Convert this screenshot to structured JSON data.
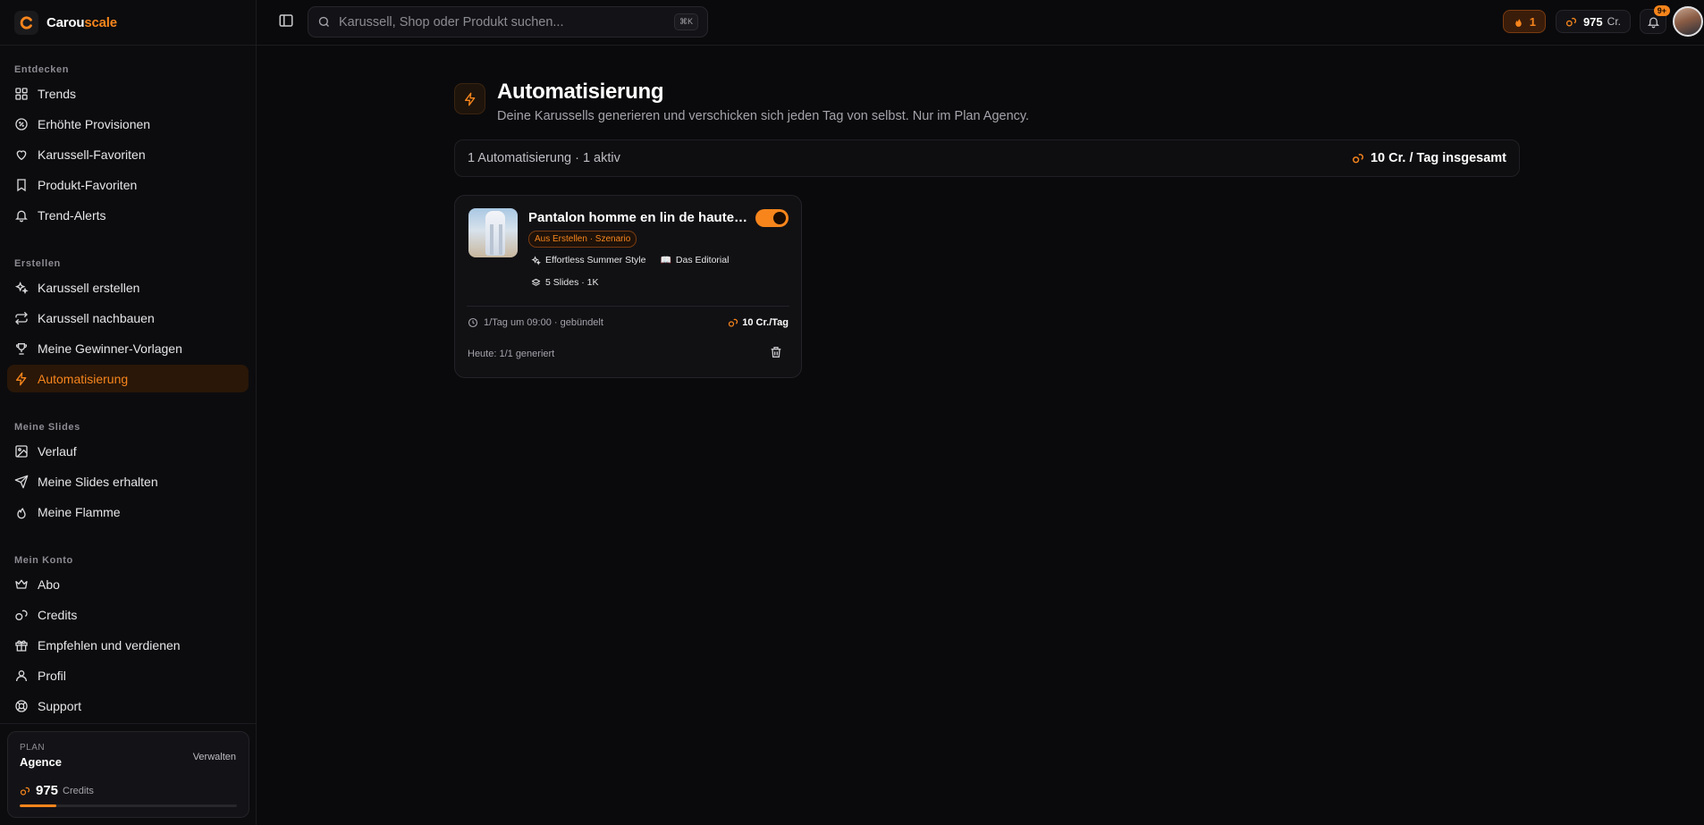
{
  "brand": {
    "prefix": "Carou",
    "accent": "scale",
    "accent_color": "#f7851c"
  },
  "sidebar": {
    "sections": [
      {
        "title": "Entdecken",
        "items": [
          {
            "label": "Trends",
            "icon": "grid-icon"
          },
          {
            "label": "Erhöhte Provisionen",
            "icon": "badge-percent-icon"
          },
          {
            "label": "Karussell-Favoriten",
            "icon": "heart-icon"
          },
          {
            "label": "Produkt-Favoriten",
            "icon": "bookmark-icon"
          },
          {
            "label": "Trend-Alerts",
            "icon": "bell-icon"
          }
        ]
      },
      {
        "title": "Erstellen",
        "items": [
          {
            "label": "Karussell erstellen",
            "icon": "sparkles-icon"
          },
          {
            "label": "Karussell nachbauen",
            "icon": "repeat-icon"
          },
          {
            "label": "Meine Gewinner-Vorlagen",
            "icon": "trophy-icon"
          },
          {
            "label": "Automatisierung",
            "icon": "zap-icon",
            "active": true
          }
        ]
      },
      {
        "title": "Meine Slides",
        "items": [
          {
            "label": "Verlauf",
            "icon": "image-icon"
          },
          {
            "label": "Meine Slides erhalten",
            "icon": "send-icon"
          },
          {
            "label": "Meine Flamme",
            "icon": "flame-icon"
          }
        ]
      },
      {
        "title": "Mein Konto",
        "items": [
          {
            "label": "Abo",
            "icon": "crown-icon"
          },
          {
            "label": "Credits",
            "icon": "coins-icon"
          },
          {
            "label": "Empfehlen und verdienen",
            "icon": "gift-icon"
          },
          {
            "label": "Profil",
            "icon": "user-icon"
          },
          {
            "label": "Support",
            "icon": "lifebuoy-icon"
          }
        ]
      }
    ],
    "plan": {
      "label": "PLAN",
      "name": "Agence",
      "manage_label": "Verwalten",
      "credits": "975",
      "credits_unit": "Credits",
      "usage_fraction": 0.17
    }
  },
  "topbar": {
    "search_placeholder": "Karussell, Shop oder Produkt suchen...",
    "search_shortcut": "⌘K",
    "streak": "1",
    "credits": "975",
    "credits_unit": "Cr.",
    "notifications_badge": "9+"
  },
  "page": {
    "title": "Automatisierung",
    "subtitle": "Deine Karussells generieren und verschicken sich jeden Tag von selbst. Nur im Plan Agency.",
    "summary_left": "1 Automatisierung · 1 aktiv",
    "summary_right": "10 Cr. / Tag insgesamt"
  },
  "automation": {
    "title": "Pantalon homme en lin de haute q...",
    "enabled": true,
    "source_tag": "Aus Erstellen · Szenario",
    "style": "Effortless Summer Style",
    "template": "Das Editorial",
    "template_emoji": "📖",
    "slides": "5 Slides · 1K",
    "schedule": "1/Tag um 09:00 · gebündelt",
    "cost": "10 Cr./Tag",
    "today": "Heute: 1/1 generiert"
  }
}
